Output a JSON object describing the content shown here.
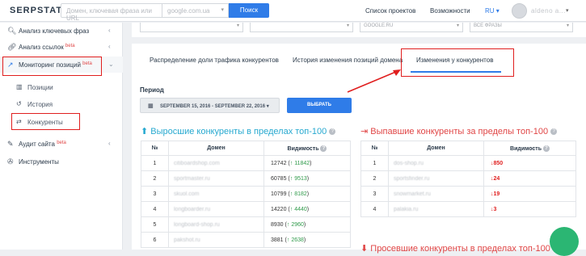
{
  "header": {
    "logo": "SERPSTAT",
    "search_placeholder": "Домен, ключевая фраза или URL",
    "domain_select": "google.com.ua",
    "search_button": "Поиск",
    "projects_link": "Список проектов",
    "features_link": "Возможности",
    "language": "RU",
    "user_name": "aldeno a..."
  },
  "sidebar": {
    "items": [
      {
        "label": "Анализ ключевых фраз",
        "icon": "search-icon"
      },
      {
        "label": "Анализ ссылок",
        "beta": "beta",
        "icon": "link-icon"
      },
      {
        "label": "Мониторинг позиций",
        "beta": "beta",
        "icon": "chart-line-icon"
      },
      {
        "label": "Аудит сайта",
        "beta": "beta",
        "icon": "wrench-icon"
      },
      {
        "label": "Инструменты",
        "icon": "tools-icon"
      }
    ],
    "sub_items": [
      {
        "label": "Позиции",
        "icon": "bar-chart-icon"
      },
      {
        "label": "История",
        "icon": "history-icon"
      },
      {
        "label": "Конкуренты",
        "icon": "arrows-icon"
      }
    ]
  },
  "filters": {
    "f1": "",
    "f2": "",
    "f3": "GOOGLE.RU",
    "f4": "ВСЕ ФРАЗЫ"
  },
  "tabs": [
    "Распределение доли трафика конкурентов",
    "История изменения позиций домена",
    "Изменения у конкурентов"
  ],
  "period": {
    "label": "Период",
    "range": "SEPTEMBER 15, 2016 - SEPTEMBER 22, 2016",
    "apply": "ВЫБРАТЬ"
  },
  "risers": {
    "title": "Выросшие конкуренты в пределах топ-100",
    "columns": [
      "№",
      "Домен",
      "Видимость"
    ],
    "rows": [
      {
        "n": "1",
        "domain": "citiboardshop.com",
        "vis": "12742",
        "delta": "11842"
      },
      {
        "n": "2",
        "domain": "sportmaster.ru",
        "vis": "60785",
        "delta": "9513"
      },
      {
        "n": "3",
        "domain": "skuol.com",
        "vis": "10799",
        "delta": "8182"
      },
      {
        "n": "4",
        "domain": "longboarder.ru",
        "vis": "14220",
        "delta": "4440"
      },
      {
        "n": "5",
        "domain": "longboard-shop.ru",
        "vis": "8930",
        "delta": "2960"
      },
      {
        "n": "6",
        "domain": "pakshot.ru",
        "vis": "3881",
        "delta": "2638"
      }
    ]
  },
  "droppers": {
    "title": "Выпавшие конкуренты за пределы топ-100",
    "columns": [
      "№",
      "Домен",
      "Видимость"
    ],
    "rows": [
      {
        "n": "1",
        "domain": "dos-shop.ru",
        "delta": "850"
      },
      {
        "n": "2",
        "domain": "sportsfinder.ru",
        "delta": "24"
      },
      {
        "n": "3",
        "domain": "snowmarket.ru",
        "delta": "19"
      },
      {
        "n": "4",
        "domain": "palakia.ru",
        "delta": "3"
      }
    ]
  },
  "new_section_title": "Просевшие конкуренты в пределах топ-100"
}
